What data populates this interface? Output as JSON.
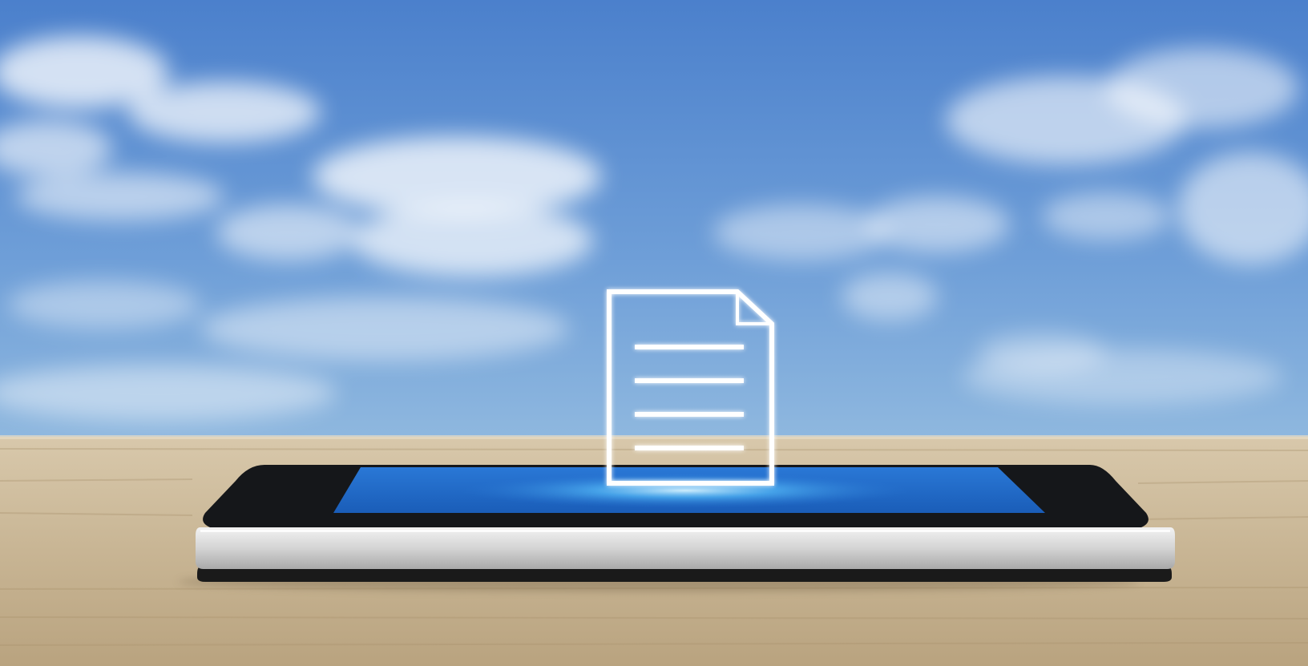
{
  "scene": {
    "subject": "document-icon-above-smartphone",
    "colors": {
      "sky_top": "#4f86cf",
      "sky_bottom": "#86b2dd",
      "wood": "#cbb89a",
      "screen_glow": "#3aa7ff",
      "icon": "#ffffff"
    }
  }
}
